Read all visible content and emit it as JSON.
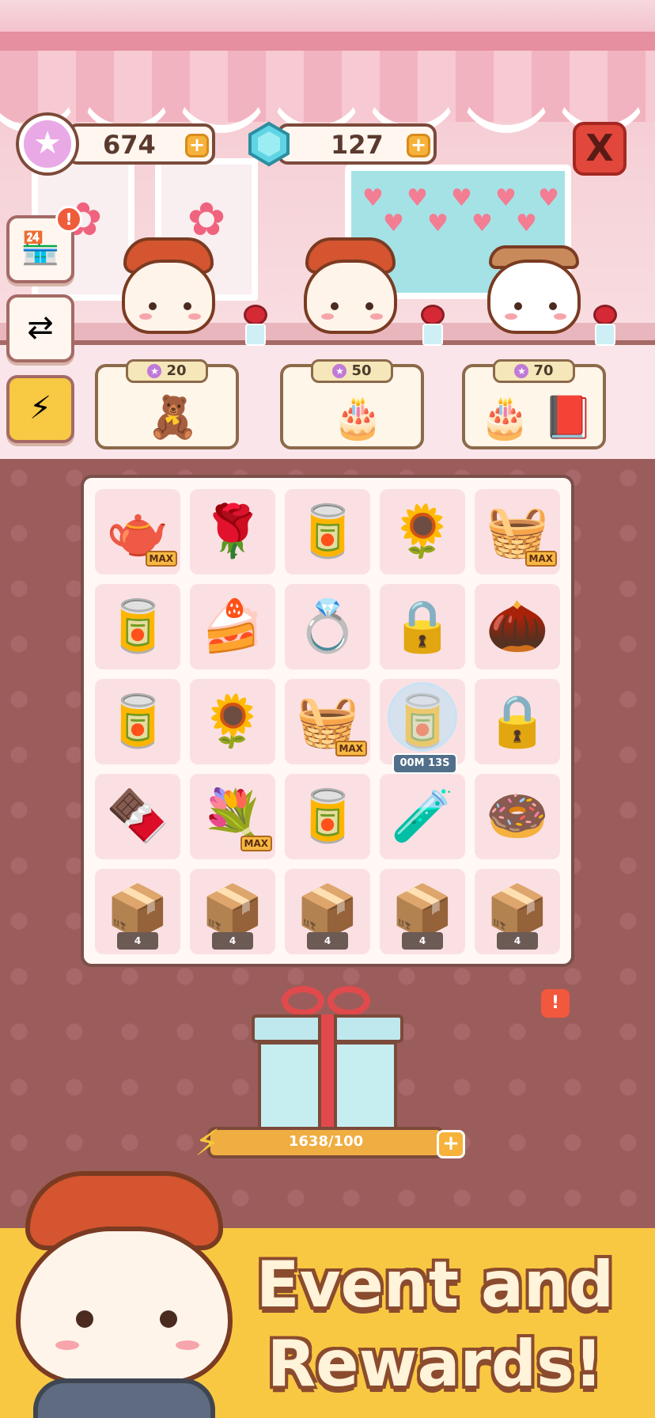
{
  "currencies": {
    "stars": "674",
    "gems": "127",
    "plus": "+"
  },
  "header": {
    "close_label": "X",
    "alert_mark": "!"
  },
  "side_buttons": [
    {
      "icon": "shop-icon",
      "glyph": "🏪"
    },
    {
      "icon": "swap-icon",
      "glyph": "⇄"
    },
    {
      "icon": "energy-icon",
      "glyph": "⚡"
    }
  ],
  "offers": [
    {
      "price": "20",
      "items": [
        "🧸"
      ]
    },
    {
      "price": "50",
      "items": [
        "🎂"
      ]
    },
    {
      "price": "70",
      "items": [
        "🎂",
        "📕"
      ]
    }
  ],
  "board": {
    "rows": [
      [
        {
          "glyph": "🫖",
          "tag": "MAX"
        },
        {
          "glyph": "🌹"
        },
        {
          "glyph": "🥫"
        },
        {
          "glyph": "🌻"
        },
        {
          "glyph": "🧺",
          "tag": "MAX"
        }
      ],
      [
        {
          "glyph": "🥫"
        },
        {
          "glyph": "🍰"
        },
        {
          "glyph": "💍"
        },
        {
          "glyph": "🔒"
        },
        {
          "glyph": "🌰"
        }
      ],
      [
        {
          "glyph": "🥫"
        },
        {
          "glyph": "🌻"
        },
        {
          "glyph": "🧺",
          "tag": "MAX"
        },
        {
          "glyph": "🥫",
          "timer": "00M 13S"
        },
        {
          "glyph": "🔒"
        }
      ],
      [
        {
          "glyph": "🍫"
        },
        {
          "glyph": "💐",
          "tag": "MAX"
        },
        {
          "glyph": "🥫"
        },
        {
          "glyph": "🧪"
        },
        {
          "glyph": "🍩"
        }
      ],
      [
        {
          "glyph": "📦",
          "lock": "4"
        },
        {
          "glyph": "📦",
          "lock": "4"
        },
        {
          "glyph": "📦",
          "lock": "4"
        },
        {
          "glyph": "📦",
          "lock": "4"
        },
        {
          "glyph": "📦",
          "lock": "4"
        }
      ]
    ]
  },
  "energy": {
    "value": "1638/100",
    "plus": "+",
    "alert_mark": "!"
  },
  "promo": {
    "line1": "Event and",
    "line2": "Rewards!"
  },
  "colors": {
    "accent_orange": "#f0ad42",
    "close_red": "#e2473c",
    "board_bg": "#9b5d5b"
  }
}
